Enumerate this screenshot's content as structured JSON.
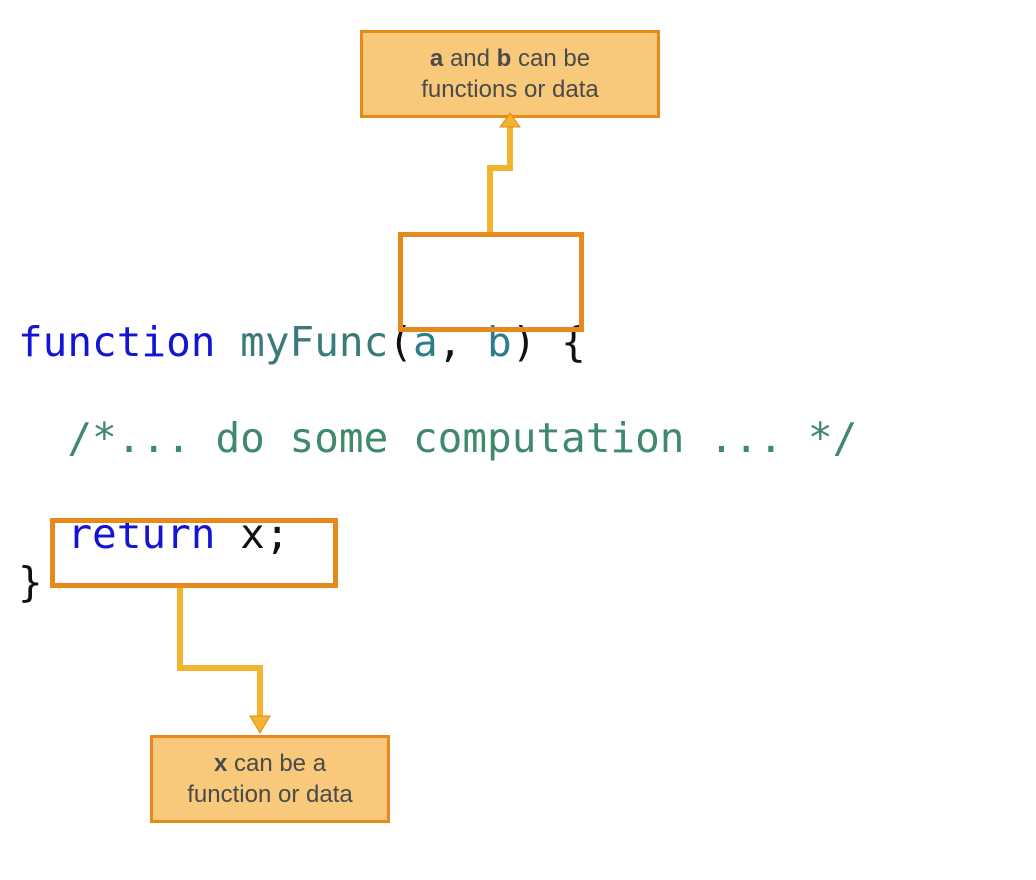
{
  "callouts": {
    "top": {
      "bold1": "a",
      "mid1": " and ",
      "bold2": "b",
      "rest": " can be functions or data"
    },
    "bottom": {
      "bold1": "x",
      "rest": " can be a function or data"
    }
  },
  "code": {
    "line1": {
      "function_kw": "function",
      "space1": " ",
      "func_name": "myFunc",
      "open_paren": "(",
      "param_a": "a",
      "comma_space": ", ",
      "param_b": "b",
      "close_paren": ")",
      "space2": " ",
      "open_brace": "{"
    },
    "line2": {
      "indent": "  ",
      "comment": "/*... do some computation ... */"
    },
    "line3": {
      "indent": "  ",
      "return_kw": "return",
      "space": " ",
      "var_x": "x",
      "semicolon": ";"
    },
    "line4": {
      "close_brace": "}"
    }
  }
}
